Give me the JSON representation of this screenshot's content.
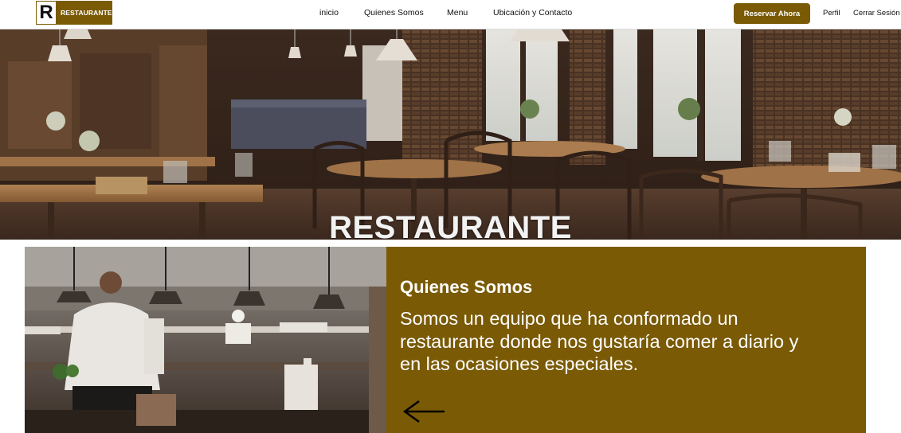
{
  "brand": {
    "logo_letter": "R",
    "name": "RESTAURANTE"
  },
  "nav": {
    "items": [
      {
        "label": "inicio"
      },
      {
        "label": "Quienes Somos"
      },
      {
        "label": "Menu"
      },
      {
        "label": "Ubicación y Contacto"
      }
    ],
    "reserve_label": "Reservar Ahora",
    "profile_label": "Perfil",
    "logout_label": "Cerrar Sesión"
  },
  "hero": {
    "title": "RESTAURANTE"
  },
  "about": {
    "heading": "Quienes Somos",
    "text": "Somos un equipo que ha conformado un restaurante donde nos gustaría comer a diario y en las ocasiones especiales.",
    "arrow_icon": "arrow-left-icon"
  },
  "colors": {
    "brand": "#7a5a05",
    "nav_background": "#ffffff",
    "text_light": "#ffffff"
  }
}
